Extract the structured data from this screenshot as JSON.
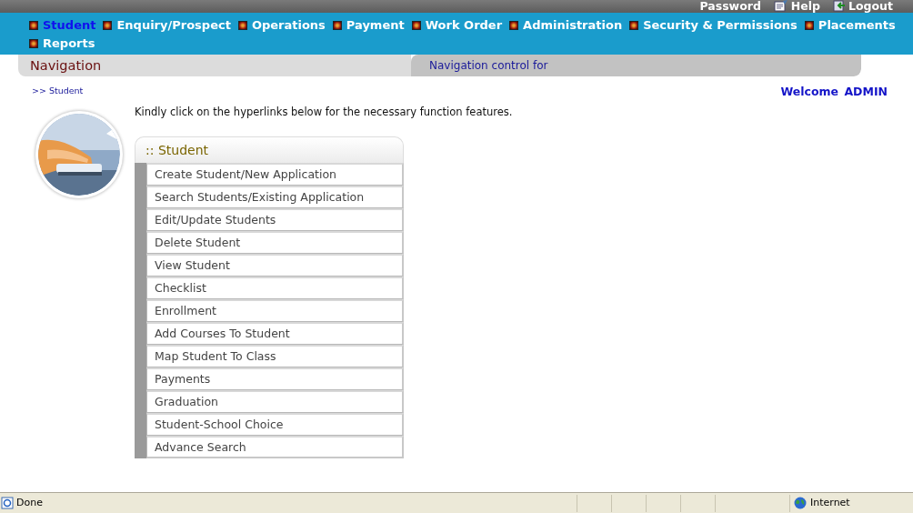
{
  "top_links": [
    {
      "kind": "text",
      "label": "Password"
    },
    {
      "kind": "help",
      "label": "Help"
    },
    {
      "kind": "logout",
      "label": "Logout"
    }
  ],
  "menu": [
    {
      "label": "Student",
      "selected": true
    },
    {
      "label": "Enquiry/Prospect",
      "selected": false
    },
    {
      "label": "Operations",
      "selected": false
    },
    {
      "label": "Payment",
      "selected": false
    },
    {
      "label": "Work Order",
      "selected": false
    },
    {
      "label": "Administration",
      "selected": false
    },
    {
      "label": "Security & Permissions",
      "selected": false
    },
    {
      "label": "Placements",
      "selected": false
    },
    {
      "label": "Reports",
      "selected": false
    }
  ],
  "navigation": {
    "title": "Navigation",
    "description": "Navigation control for"
  },
  "breadcrumb": ">> Student",
  "welcome": "Welcome  ADMIN",
  "instruction": "Kindly click on the hyperlinks below for the necessary function features.",
  "panel": {
    "title": ":: Student",
    "links": [
      "Create Student/New Application",
      "Search Students/Existing Application",
      "Edit/Update Students",
      "Delete Student",
      "View Student",
      "Checklist",
      "Enrollment",
      "Add Courses To Student",
      "Map Student To Class",
      "Payments",
      "Graduation",
      "Student-School Choice",
      "Advance Search"
    ]
  },
  "status_bar": {
    "status": "Done",
    "zone": "Internet"
  }
}
